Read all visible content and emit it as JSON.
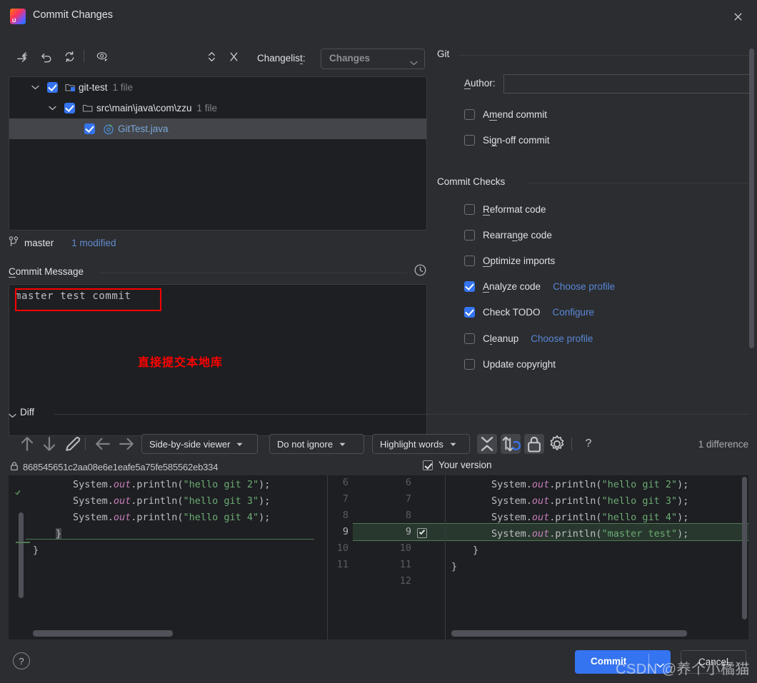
{
  "window": {
    "title": "Commit Changes",
    "logo_icon": "intellij-idea-logo",
    "close_icon": "close-icon"
  },
  "changes_toolbar": {
    "icons": [
      {
        "name": "move-to-changelist-icon",
        "glyph": "move-arrow"
      },
      {
        "name": "revert-icon",
        "glyph": "undo-arrow"
      },
      {
        "name": "refresh-icon",
        "glyph": "refresh-arrows"
      },
      {
        "name": "show-diff-preview-icon",
        "glyph": "eye"
      },
      {
        "name": "expand-collapse-icon",
        "glyph": "up-down-chevrons"
      },
      {
        "name": "collapse-all-icon",
        "glyph": "x-collapse"
      }
    ],
    "changelist_label": "Changelist:",
    "changelist_value": "Changes"
  },
  "file_tree": [
    {
      "level": 0,
      "checked": true,
      "expanded": true,
      "icon": "module-folder-icon",
      "label": "git-test",
      "count": "1 file",
      "selected": false,
      "is_file": false
    },
    {
      "level": 1,
      "checked": true,
      "expanded": true,
      "icon": "folder-icon",
      "label": "src\\main\\java\\com\\zzu",
      "count": "1 file",
      "selected": false,
      "is_file": false
    },
    {
      "level": 2,
      "checked": true,
      "expanded": null,
      "icon": "java-class-icon",
      "label": "GitTest.java",
      "count": "",
      "selected": true,
      "is_file": true
    }
  ],
  "branch_bar": {
    "icon": "branch-icon",
    "branch": "master",
    "status": "1 modified"
  },
  "commit_message": {
    "section_title": "Commit Message",
    "history_icon": "clock-history-icon",
    "text": "master test commit",
    "annotation": "直接提交本地库"
  },
  "git_section": {
    "title": "Git",
    "author_label": "Author:",
    "author_value": "",
    "author_placeholder": "",
    "options": [
      {
        "label": "Amend commit",
        "checked": false,
        "mnemonic": "m"
      },
      {
        "label": "Sign-off commit",
        "checked": false,
        "mnemonic": "g"
      }
    ]
  },
  "commit_checks": {
    "title": "Commit Checks",
    "options": [
      {
        "label": "Reformat code",
        "checked": false,
        "link": ""
      },
      {
        "label": "Rearrange code",
        "checked": false,
        "link": ""
      },
      {
        "label": "Optimize imports",
        "checked": false,
        "link": ""
      },
      {
        "label": "Analyze code",
        "checked": true,
        "link": "Choose profile"
      },
      {
        "label": "Check TODO",
        "checked": true,
        "link": "Configure"
      },
      {
        "label": "Cleanup",
        "checked": false,
        "link": "Choose profile"
      },
      {
        "label": "Update copyright",
        "checked": false,
        "link": ""
      }
    ]
  },
  "diff": {
    "section_title": "Diff",
    "toolbar": {
      "prev_diff_icon": "arrow-up-icon",
      "next_diff_icon": "arrow-down-icon",
      "edit_icon": "pencil-icon",
      "prev_change_icon": "arrow-left-icon",
      "next_change_icon": "arrow-right-icon",
      "viewer_mode": "Side-by-side viewer",
      "ignore_mode": "Do not ignore",
      "highlight_mode": "Highlight words",
      "collapse_icon": "collapse-unchanged-icon",
      "sync_scroll_icon": "sync-scroll-icon",
      "lock_icon": "lock-icon",
      "settings_icon": "gear-icon",
      "help_icon": "question-mark-icon",
      "difference_count": "1 difference"
    },
    "left_header": {
      "lock_icon": "lock-icon",
      "revision": "868545651c2aa08e6e1eafe5a75fe585562eb334"
    },
    "right_header": {
      "checked": true,
      "label": "Your version"
    },
    "left_lines": [
      {
        "num": "6",
        "indent": 8,
        "code": "System.out.println(\"hello git 2\");",
        "type": "context"
      },
      {
        "num": "7",
        "indent": 8,
        "code": "System.out.println(\"hello git 3\");",
        "type": "context"
      },
      {
        "num": "8",
        "indent": 8,
        "code": "System.out.println(\"hello git 4\");",
        "type": "context"
      },
      {
        "num": "9",
        "indent": 4,
        "code": "}",
        "type": "context"
      },
      {
        "num": "10",
        "indent": 0,
        "code": "}",
        "type": "context"
      },
      {
        "num": "11",
        "indent": 0,
        "code": "",
        "type": "context"
      }
    ],
    "right_lines": [
      {
        "num": "6",
        "indent": 8,
        "code": "System.out.println(\"hello git 2\");",
        "type": "context",
        "checked": false
      },
      {
        "num": "7",
        "indent": 8,
        "code": "System.out.println(\"hello git 3\");",
        "type": "context",
        "checked": false
      },
      {
        "num": "8",
        "indent": 8,
        "code": "System.out.println(\"hello git 4\");",
        "type": "context",
        "checked": false
      },
      {
        "num": "9",
        "indent": 8,
        "code": "System.out.println(\"master test\");",
        "type": "added",
        "checked": true
      },
      {
        "num": "10",
        "indent": 4,
        "code": "}",
        "type": "context",
        "checked": false
      },
      {
        "num": "11",
        "indent": 0,
        "code": "}",
        "type": "context",
        "checked": false
      },
      {
        "num": "12",
        "indent": 0,
        "code": "",
        "type": "context",
        "checked": false
      }
    ]
  },
  "footer": {
    "help_label": "?",
    "commit_label": "Commit",
    "commit_dropdown_icon": "chevron-down-icon",
    "cancel_label": "Cancel",
    "watermark": "CSDN @养个小橘猫"
  },
  "colors": {
    "accent": "#3574f0",
    "link": "#5a87d8",
    "annotation": "#ff0000",
    "added": "#29382e",
    "panel": "#2b2d30",
    "field": "#1e1f22"
  }
}
